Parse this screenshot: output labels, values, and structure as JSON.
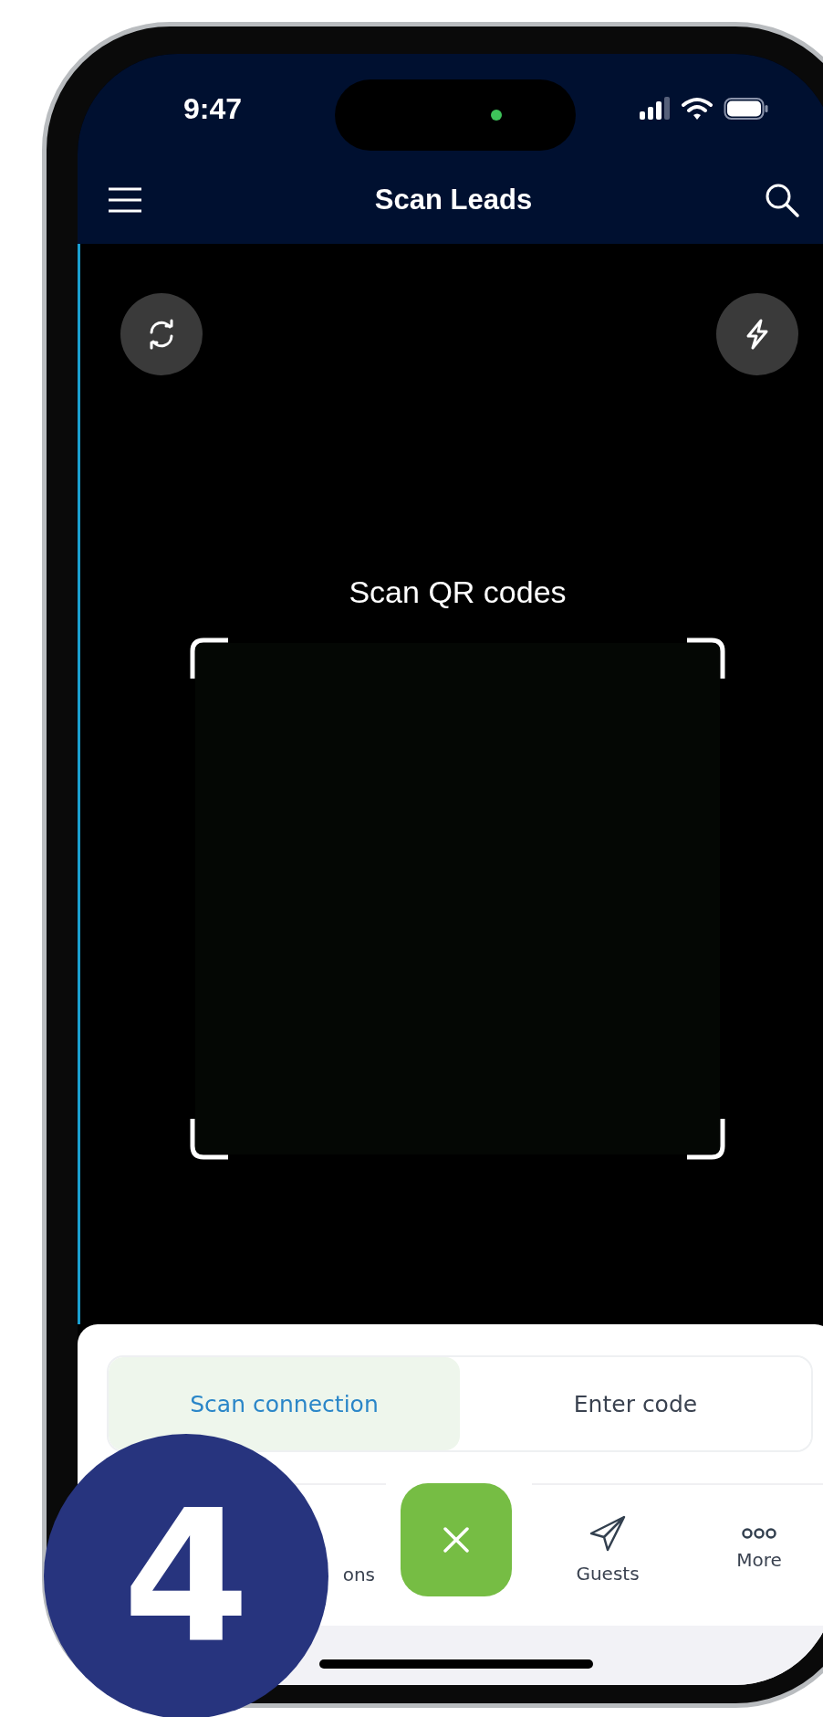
{
  "status_bar": {
    "time": "9:47"
  },
  "nav_bar": {
    "title": "Scan Leads"
  },
  "scanner": {
    "prompt": "Scan QR codes"
  },
  "mode_tabs": [
    {
      "label": "Scan connection",
      "selected": true
    },
    {
      "label": "Enter code",
      "selected": false
    }
  ],
  "bottom_nav": [
    {
      "label": "ons",
      "kind": "label"
    },
    {
      "label": "Guests",
      "kind": "send"
    },
    {
      "label": "More",
      "kind": "more"
    }
  ],
  "step_badge": "4"
}
